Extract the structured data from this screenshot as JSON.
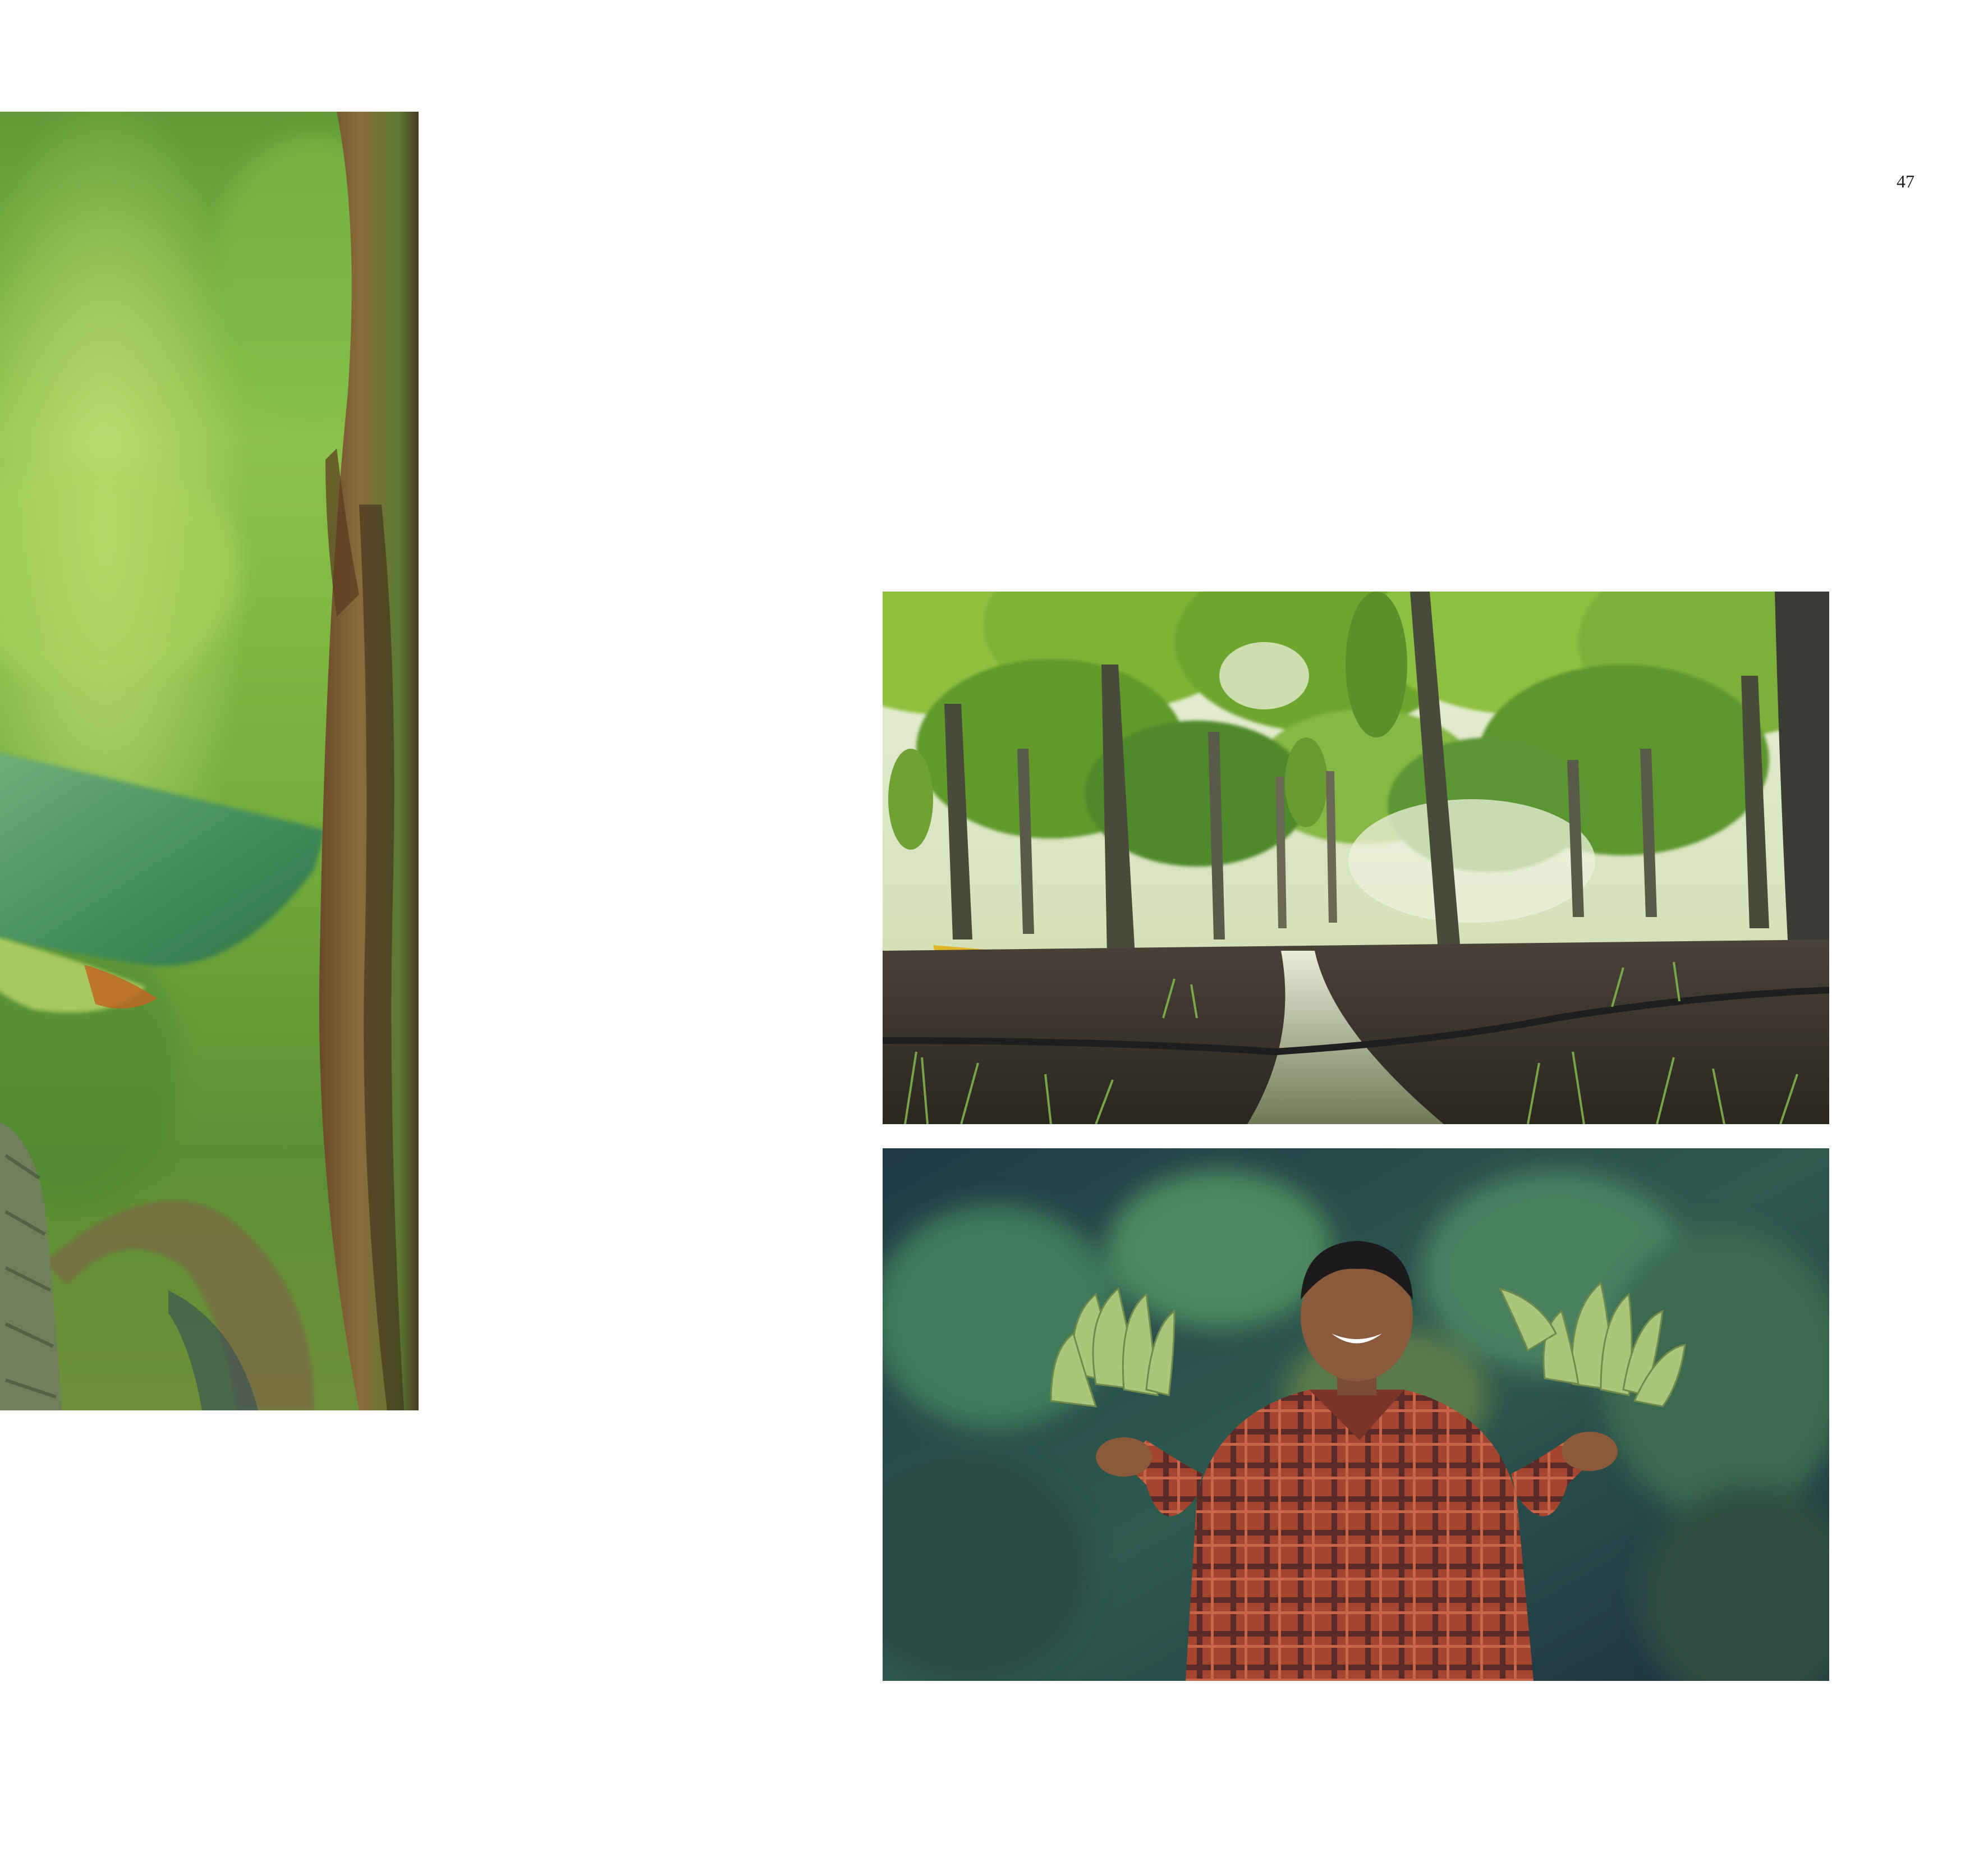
{
  "page": {
    "number": "47"
  },
  "photos": [
    {
      "subject": "banana-leaf-closeup"
    },
    {
      "subject": "banana-plantation-irrigation-channel"
    },
    {
      "subject": "farmer-holding-banana-bunches"
    }
  ],
  "colors": {
    "background": "#ffffff",
    "text": "#1f1f1f",
    "leaf_green": "#7cb342",
    "deep_green": "#3e6b2a",
    "shirt_red": "#a3452f"
  }
}
